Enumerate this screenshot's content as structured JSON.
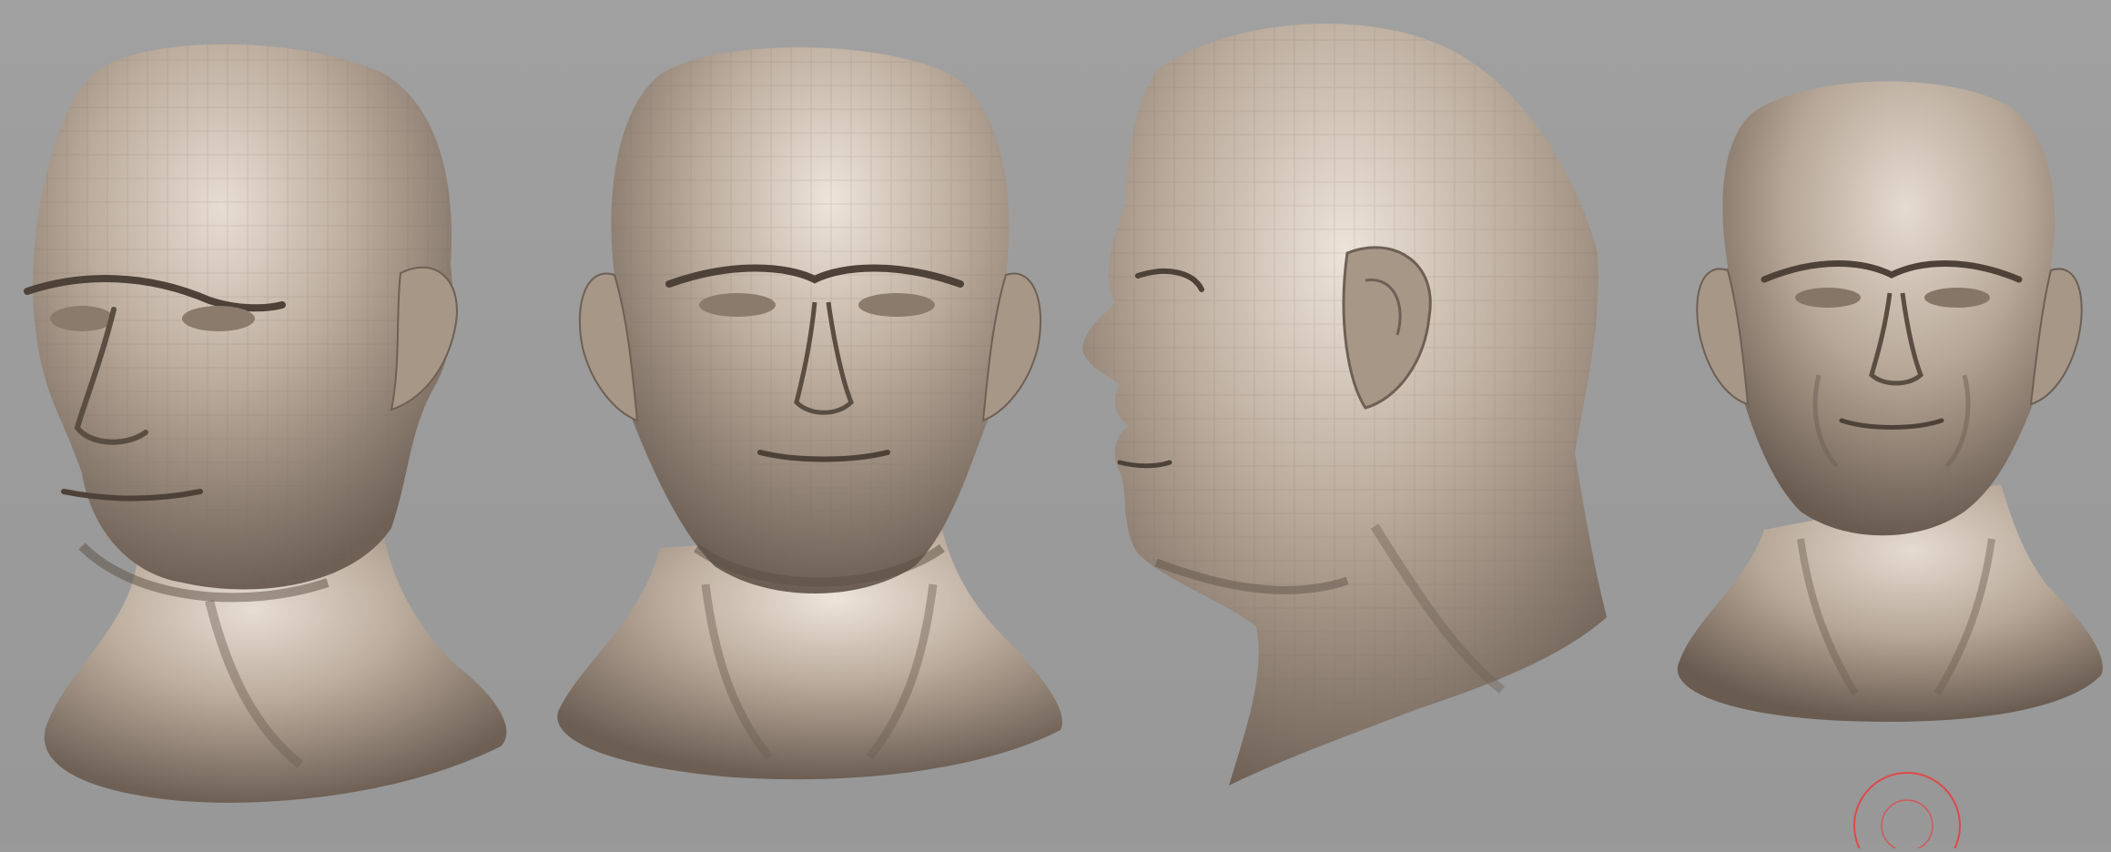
{
  "scene": {
    "background_color": "#9a9a9a",
    "material_color": "#b9ab9c",
    "highlight_color": "#e8ddd3",
    "shadow_color": "#5a4d42",
    "gizmo_color": "#e04848"
  },
  "views": [
    {
      "name": "three-quarter-left"
    },
    {
      "name": "front"
    },
    {
      "name": "side-profile-left"
    },
    {
      "name": "front-smoothed"
    }
  ]
}
